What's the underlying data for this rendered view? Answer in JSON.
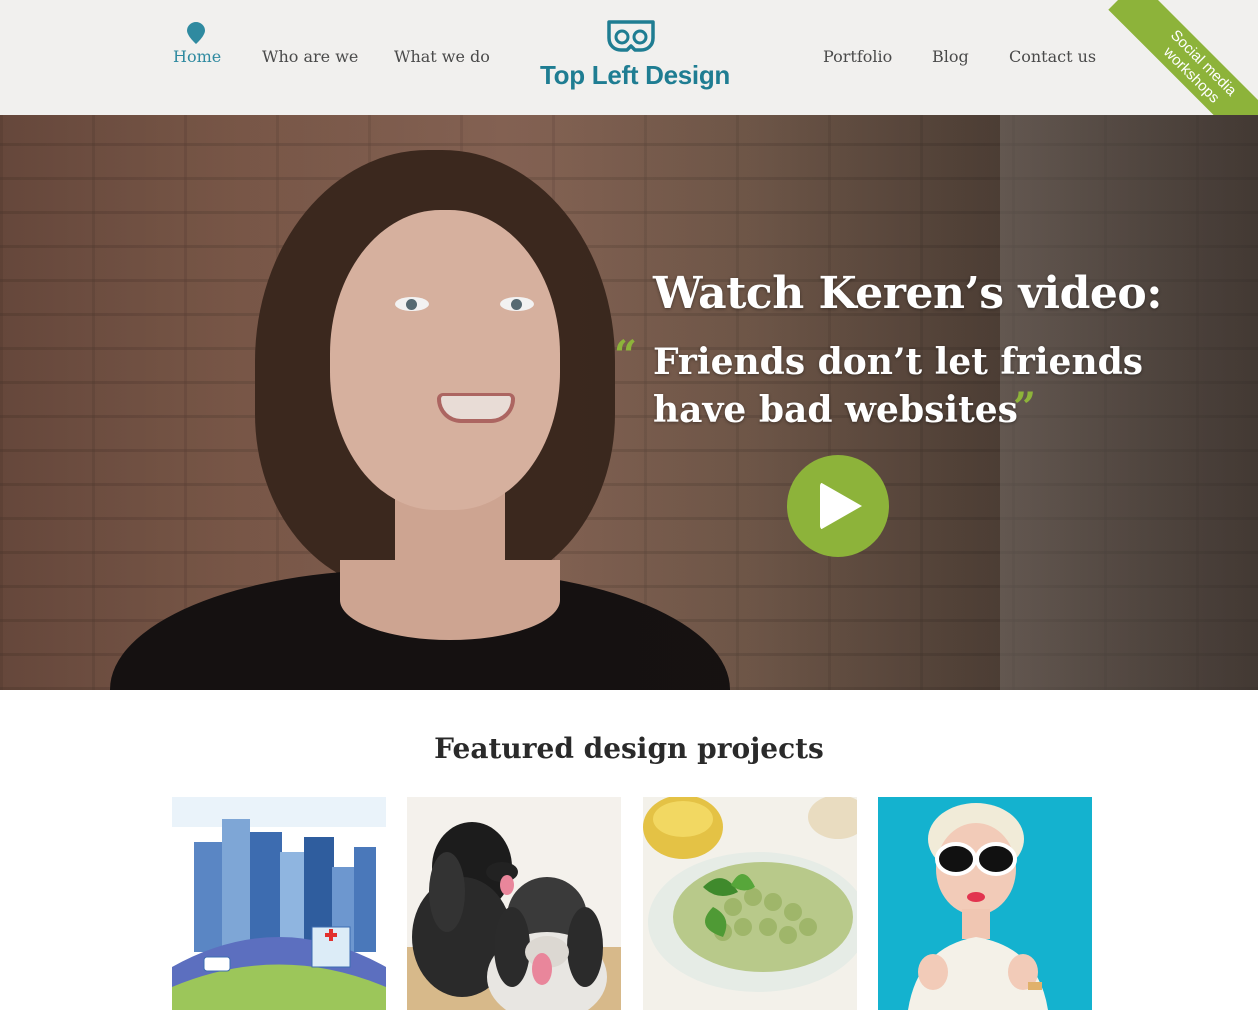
{
  "header": {
    "nav_left": [
      {
        "label": "Home",
        "active": true
      },
      {
        "label": "Who are we",
        "active": false
      },
      {
        "label": "What we do",
        "active": false
      }
    ],
    "nav_right": [
      {
        "label": "Portfolio"
      },
      {
        "label": "Blog"
      },
      {
        "label": "Contact us"
      }
    ],
    "logo_text": "Top Left Design",
    "ribbon": {
      "line1": "Social media",
      "line2": "workshops"
    }
  },
  "hero": {
    "title": "Watch Keren’s video:",
    "quote_line1": "Friends don’t let friends",
    "quote_line2": "have bad websites",
    "quote_open": "“",
    "quote_close": "”"
  },
  "featured": {
    "title": "Featured design projects",
    "projects": [
      {
        "image": "city-illustration"
      },
      {
        "image": "spaniel-dogs-photo"
      },
      {
        "image": "pasta-dish-photo"
      },
      {
        "image": "woman-sunglasses-photo"
      }
    ]
  },
  "colors": {
    "brand_teal": "#1f7d92",
    "accent_green": "#8db33a",
    "header_bg": "#f1f0ee"
  }
}
